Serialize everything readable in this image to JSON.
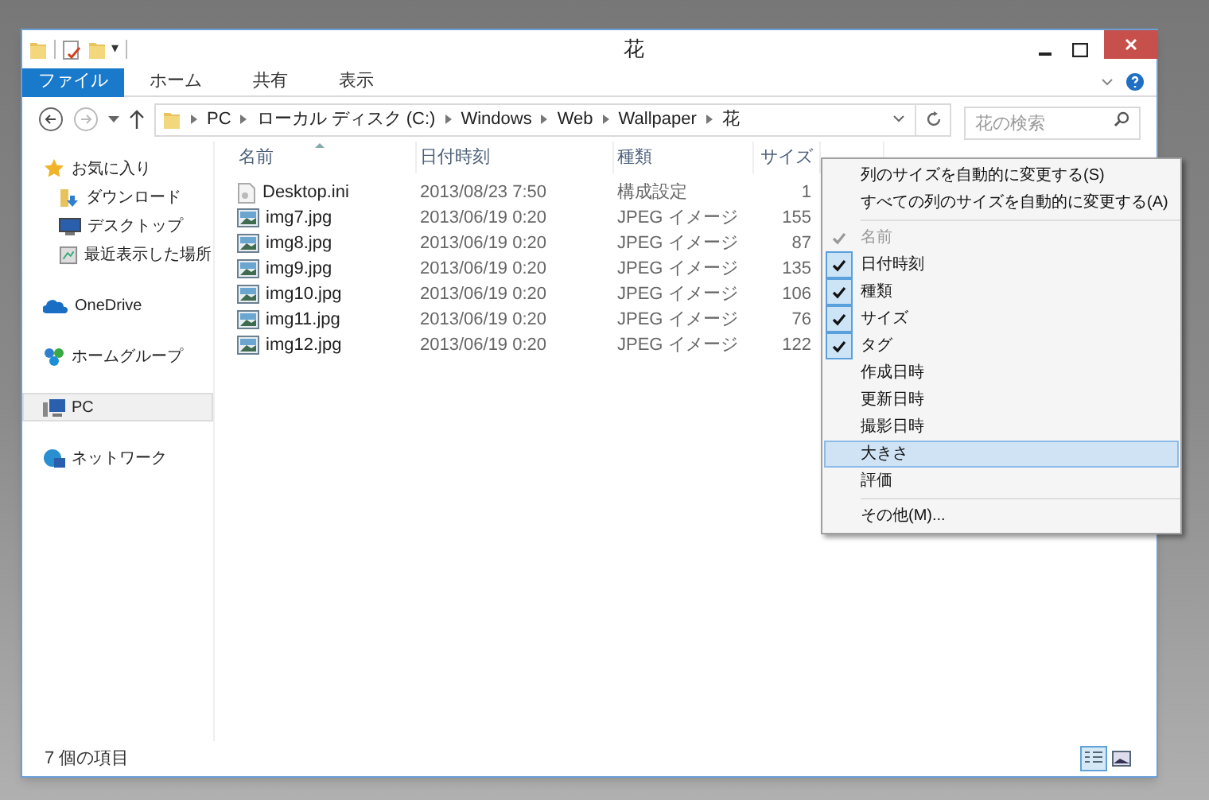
{
  "window": {
    "title": "花",
    "quick_access": [
      "▾"
    ]
  },
  "ribbon_tabs": [
    {
      "label": "ファイル",
      "selected": true
    },
    {
      "label": "ホーム",
      "selected": false
    },
    {
      "label": "共有",
      "selected": false
    },
    {
      "label": "表示",
      "selected": false
    }
  ],
  "address_bar": {
    "path": [
      "PC",
      "ローカル ディスク (C:)",
      "Windows",
      "Web",
      "Wallpaper",
      "花"
    ]
  },
  "search": {
    "placeholder": "花の検索"
  },
  "navigation": [
    {
      "label": "お気に入り",
      "kind": "favorites",
      "selected": false,
      "children": [
        {
          "label": "ダウンロード",
          "kind": "download",
          "selected": false
        },
        {
          "label": "デスクトップ",
          "kind": "desktop",
          "selected": false
        },
        {
          "label": "最近表示した場所",
          "kind": "recent",
          "selected": false
        }
      ]
    },
    {
      "label": "OneDrive",
      "kind": "cloud",
      "selected": false
    },
    {
      "label": "ホームグループ",
      "kind": "homegroup",
      "selected": false
    },
    {
      "label": "PC",
      "kind": "pc",
      "selected": true
    },
    {
      "label": "ネットワーク",
      "kind": "network",
      "selected": false
    }
  ],
  "table": {
    "columns": [
      "名前",
      "日付時刻",
      "種類",
      "サイズ"
    ],
    "rows": [
      {
        "kind": "ini",
        "cells": [
          "Desktop.ini",
          "2013/08/23 7:50",
          "構成設定",
          "1"
        ]
      },
      {
        "kind": "image",
        "cells": [
          "img7.jpg",
          "2013/06/19 0:20",
          "JPEG イメージ",
          "155"
        ]
      },
      {
        "kind": "image",
        "cells": [
          "img8.jpg",
          "2013/06/19 0:20",
          "JPEG イメージ",
          "87"
        ]
      },
      {
        "kind": "image",
        "cells": [
          "img9.jpg",
          "2013/06/19 0:20",
          "JPEG イメージ",
          "135"
        ]
      },
      {
        "kind": "image",
        "cells": [
          "img10.jpg",
          "2013/06/19 0:20",
          "JPEG イメージ",
          "106"
        ]
      },
      {
        "kind": "image",
        "cells": [
          "img11.jpg",
          "2013/06/19 0:20",
          "JPEG イメージ",
          "76"
        ]
      },
      {
        "kind": "image",
        "cells": [
          "img12.jpg",
          "2013/06/19 0:20",
          "JPEG イメージ",
          "122"
        ]
      }
    ]
  },
  "context_menu": {
    "groups": [
      [
        {
          "label": "列のサイズを自動的に変更する(S)",
          "checked": false,
          "disabled": false,
          "selected": false
        },
        {
          "label": "すべての列のサイズを自動的に変更する(A)",
          "checked": false,
          "disabled": false,
          "selected": false
        }
      ],
      [
        {
          "label": "名前",
          "checked": true,
          "disabled": true,
          "selected": false
        },
        {
          "label": "日付時刻",
          "checked": true,
          "disabled": false,
          "selected": false
        },
        {
          "label": "種類",
          "checked": true,
          "disabled": false,
          "selected": false
        },
        {
          "label": "サイズ",
          "checked": true,
          "disabled": false,
          "selected": false
        },
        {
          "label": "タグ",
          "checked": true,
          "disabled": false,
          "selected": false
        },
        {
          "label": "作成日時",
          "checked": false,
          "disabled": false,
          "selected": false
        },
        {
          "label": "更新日時",
          "checked": false,
          "disabled": false,
          "selected": false
        },
        {
          "label": "撮影日時",
          "checked": false,
          "disabled": false,
          "selected": false
        },
        {
          "label": "大きさ",
          "checked": false,
          "disabled": false,
          "selected": true
        },
        {
          "label": "評価",
          "checked": false,
          "disabled": false,
          "selected": false
        }
      ],
      [
        {
          "label": "その他(M)...",
          "checked": false,
          "disabled": false,
          "selected": false
        }
      ]
    ]
  },
  "status_bar": {
    "item_count": "7 個の項目"
  },
  "view_buttons": [
    {
      "kind": "details",
      "selected": true
    },
    {
      "kind": "thumbnails",
      "selected": false
    }
  ]
}
